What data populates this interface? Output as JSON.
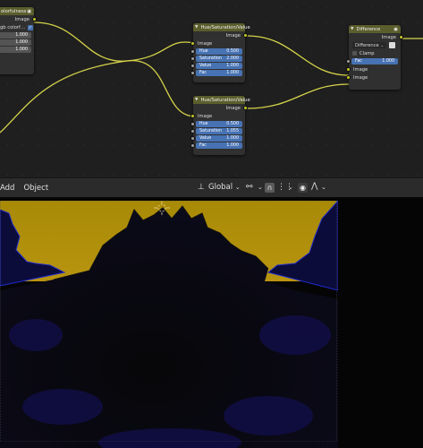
{
  "colors": {
    "socket_color": "#c7c729",
    "socket_grey": "#a1a1a1",
    "field_blue": "#4772b3",
    "node_header": "#5a5e2c",
    "link_color": "#d6d34a",
    "sky_yellow": "#b08f08"
  },
  "node_colorfulness": {
    "title": "olorfulness",
    "output_label": "Image",
    "dropdown_value": "gb colorf…",
    "fields": [
      "1.000",
      "1.000",
      "1.000"
    ]
  },
  "node_hsv1": {
    "title": "Hue/Saturation/Value",
    "output_label": "Image",
    "input_label": "Image",
    "fields": [
      {
        "label": "Hue",
        "value": "0.500"
      },
      {
        "label": "Saturation",
        "value": "2.000"
      },
      {
        "label": "Value",
        "value": "1.000"
      },
      {
        "label": "Fac",
        "value": "1.000"
      }
    ]
  },
  "node_hsv2": {
    "title": "Hue/Saturation/Value",
    "output_label": "Image",
    "input_label": "Image",
    "fields": [
      {
        "label": "Hue",
        "value": "0.500"
      },
      {
        "label": "Saturation",
        "value": "1.055"
      },
      {
        "label": "Value",
        "value": "1.000"
      },
      {
        "label": "Fac",
        "value": "1.000"
      }
    ]
  },
  "node_difference": {
    "title": "Difference",
    "output_label": "Image",
    "blend_mode": "Difference",
    "clamp_label": "Clamp",
    "fac_label": "Fac",
    "fac_value": "1.000",
    "input1_label": "Image",
    "input2_label": "Image"
  },
  "header": {
    "menu_add": "Add",
    "menu_object": "Object",
    "orientation": "Global",
    "icons": [
      "orientation-icon",
      "link-icon",
      "snap-icon",
      "proportional-icon",
      "falloff-icon"
    ]
  }
}
